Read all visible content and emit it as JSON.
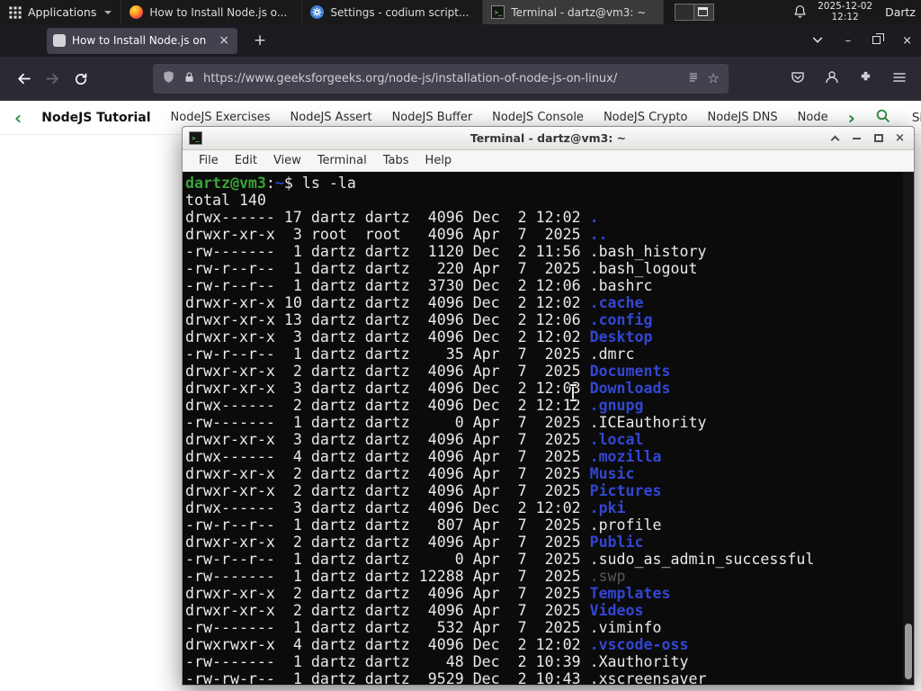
{
  "panel": {
    "applications": {
      "label": "Applications"
    },
    "window_buttons": [
      {
        "label": "How to Install Node.js o...",
        "icon": "firefox-icon"
      },
      {
        "label": "Settings - codium script...",
        "icon": "settings-gear-icon"
      },
      {
        "label": "Terminal - dartz@vm3: ~",
        "icon": "terminal-icon",
        "active": true
      }
    ],
    "clock": {
      "date": "2025-12-02",
      "time": "12:12"
    },
    "user": "Dartz"
  },
  "browser": {
    "tab": {
      "title": "How to Install Node.js on",
      "close_glyph": "×"
    },
    "new_tab_glyph": "+",
    "window_controls": {
      "minimize": "–",
      "close": "×"
    },
    "url": "https://www.geeksforgeeks.org/node-js/installation-of-node-js-on-linux/",
    "star_glyph": "☆",
    "site_nav": {
      "back_chevron": "‹",
      "brand": "NodeJS Tutorial",
      "links": [
        "NodeJS Exercises",
        "NodeJS Assert",
        "NodeJS Buffer",
        "NodeJS Console",
        "NodeJS Crypto",
        "NodeJS DNS",
        "Node"
      ],
      "forward_chevron": "›",
      "sign_in": "Sign In"
    }
  },
  "terminal": {
    "title": "Terminal - dartz@vm3: ~",
    "menu": [
      "File",
      "Edit",
      "View",
      "Terminal",
      "Tabs",
      "Help"
    ],
    "window_controls": {
      "close": "×"
    },
    "prompt": {
      "user_host": "dartz@vm3",
      "colon": ":",
      "path": "~",
      "dollar": "$ ",
      "command": "ls -la"
    },
    "total_line": "total 140",
    "listing": [
      {
        "meta": "drwx------ 17 dartz dartz  4096 Dec  2 12:02 ",
        "name": ".",
        "type": "dir"
      },
      {
        "meta": "drwxr-xr-x  3 root  root   4096 Apr  7  2025 ",
        "name": "..",
        "type": "dir"
      },
      {
        "meta": "-rw-------  1 dartz dartz  1120 Dec  2 11:56 ",
        "name": ".bash_history",
        "type": "file"
      },
      {
        "meta": "-rw-r--r--  1 dartz dartz   220 Apr  7  2025 ",
        "name": ".bash_logout",
        "type": "file"
      },
      {
        "meta": "-rw-r--r--  1 dartz dartz  3730 Dec  2 12:06 ",
        "name": ".bashrc",
        "type": "file"
      },
      {
        "meta": "drwxr-xr-x 10 dartz dartz  4096 Dec  2 12:02 ",
        "name": ".cache",
        "type": "dir"
      },
      {
        "meta": "drwxr-xr-x 13 dartz dartz  4096 Dec  2 12:06 ",
        "name": ".config",
        "type": "dir"
      },
      {
        "meta": "drwxr-xr-x  3 dartz dartz  4096 Dec  2 12:02 ",
        "name": "Desktop",
        "type": "dir"
      },
      {
        "meta": "-rw-r--r--  1 dartz dartz    35 Apr  7  2025 ",
        "name": ".dmrc",
        "type": "file"
      },
      {
        "meta": "drwxr-xr-x  2 dartz dartz  4096 Apr  7  2025 ",
        "name": "Documents",
        "type": "dir"
      },
      {
        "meta": "drwxr-xr-x  3 dartz dartz  4096 Dec  2 12:03 ",
        "name": "Downloads",
        "type": "dir"
      },
      {
        "meta": "drwx------  2 dartz dartz  4096 Dec  2 12:12 ",
        "name": ".gnupg",
        "type": "dir"
      },
      {
        "meta": "-rw-------  1 dartz dartz     0 Apr  7  2025 ",
        "name": ".ICEauthority",
        "type": "file"
      },
      {
        "meta": "drwxr-xr-x  3 dartz dartz  4096 Apr  7  2025 ",
        "name": ".local",
        "type": "dir"
      },
      {
        "meta": "drwx------  4 dartz dartz  4096 Apr  7  2025 ",
        "name": ".mozilla",
        "type": "dir"
      },
      {
        "meta": "drwxr-xr-x  2 dartz dartz  4096 Apr  7  2025 ",
        "name": "Music",
        "type": "dir"
      },
      {
        "meta": "drwxr-xr-x  2 dartz dartz  4096 Apr  7  2025 ",
        "name": "Pictures",
        "type": "dir"
      },
      {
        "meta": "drwx------  3 dartz dartz  4096 Dec  2 12:02 ",
        "name": ".pki",
        "type": "dir"
      },
      {
        "meta": "-rw-r--r--  1 dartz dartz   807 Apr  7  2025 ",
        "name": ".profile",
        "type": "file"
      },
      {
        "meta": "drwxr-xr-x  2 dartz dartz  4096 Apr  7  2025 ",
        "name": "Public",
        "type": "dir"
      },
      {
        "meta": "-rw-r--r--  1 dartz dartz     0 Apr  7  2025 ",
        "name": ".sudo_as_admin_successful",
        "type": "file"
      },
      {
        "meta": "-rw-------  1 dartz dartz 12288 Apr  7  2025 ",
        "name": ".swp",
        "type": "dim"
      },
      {
        "meta": "drwxr-xr-x  2 dartz dartz  4096 Apr  7  2025 ",
        "name": "Templates",
        "type": "dir"
      },
      {
        "meta": "drwxr-xr-x  2 dartz dartz  4096 Apr  7  2025 ",
        "name": "Videos",
        "type": "dir"
      },
      {
        "meta": "-rw-------  1 dartz dartz   532 Apr  7  2025 ",
        "name": ".viminfo",
        "type": "file"
      },
      {
        "meta": "drwxrwxr-x  4 dartz dartz  4096 Dec  2 12:02 ",
        "name": ".vscode-oss",
        "type": "dir"
      },
      {
        "meta": "-rw-------  1 dartz dartz    48 Dec  2 10:39 ",
        "name": ".Xauthority",
        "type": "file"
      },
      {
        "meta": "-rw-rw-r--  1 dartz dartz  9529 Dec  2 10:43 ",
        "name": ".xscreensaver",
        "type": "file"
      }
    ]
  },
  "colors": {
    "gfg_green": "#2f8d46",
    "dir_blue": "#3246d2",
    "prompt_green": "#3aa33a",
    "terminal_bg": "#0b0b0b",
    "terminal_fg": "#e9e9e9"
  }
}
